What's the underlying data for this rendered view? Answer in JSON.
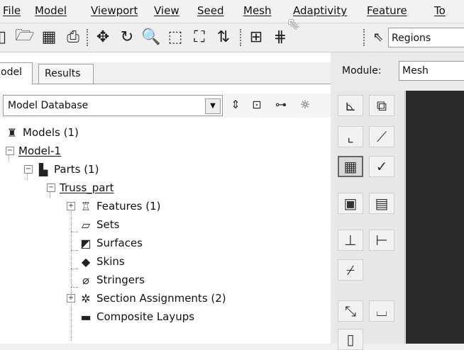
{
  "menubar": {
    "items": [
      "File",
      "Model",
      "Viewport",
      "View",
      "Seed",
      "Mesh",
      "Adaptivity",
      "Feature",
      "To"
    ]
  },
  "toolbar": {
    "icons": [
      "open-folder-icon",
      "save-icon",
      "print-icon",
      "pan-icon",
      "rotate-icon",
      "zoom-icon",
      "box-zoom-icon",
      "auto-fit-icon",
      "cycle-views-icon",
      "mesh-grid-icon",
      "mesh-grid-alt-icon",
      "select-arrow-icon"
    ],
    "selection_filter": "Regions"
  },
  "tabs": [
    "odel",
    "Results"
  ],
  "model_db": {
    "label": "Model Database"
  },
  "tree": {
    "models": "Models (1)",
    "model1": "Model-1",
    "parts": "Parts (1)",
    "truss": "Truss_part",
    "features": "Features (1)",
    "sets": "Sets",
    "surfaces": "Surfaces",
    "skins": "Skins",
    "stringers": "Stringers",
    "section_assignments": "Section Assignments (2)",
    "composite": "Composite Layups"
  },
  "module": {
    "label": "Module:",
    "value": "Mesh"
  }
}
